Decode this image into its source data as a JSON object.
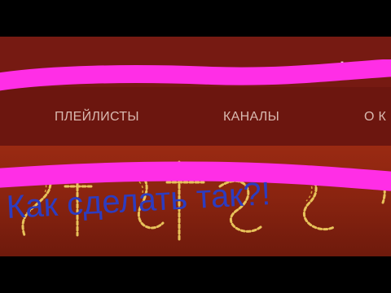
{
  "tabs": [
    {
      "label": "ПЛЕЙЛИСТЫ"
    },
    {
      "label": "КАНАЛЫ"
    },
    {
      "label": "О К"
    }
  ],
  "overlay": {
    "caption": "Как сделать так?!",
    "caption_color": "#2d3cc0",
    "marker_color": "#ff2ee6"
  },
  "banner": {
    "text_fragment": "sFire"
  },
  "colors": {
    "header": "#761a12",
    "tab_bar": "#6c160f",
    "banner": "#8a2410",
    "tab_text": "#d9b9b0"
  }
}
